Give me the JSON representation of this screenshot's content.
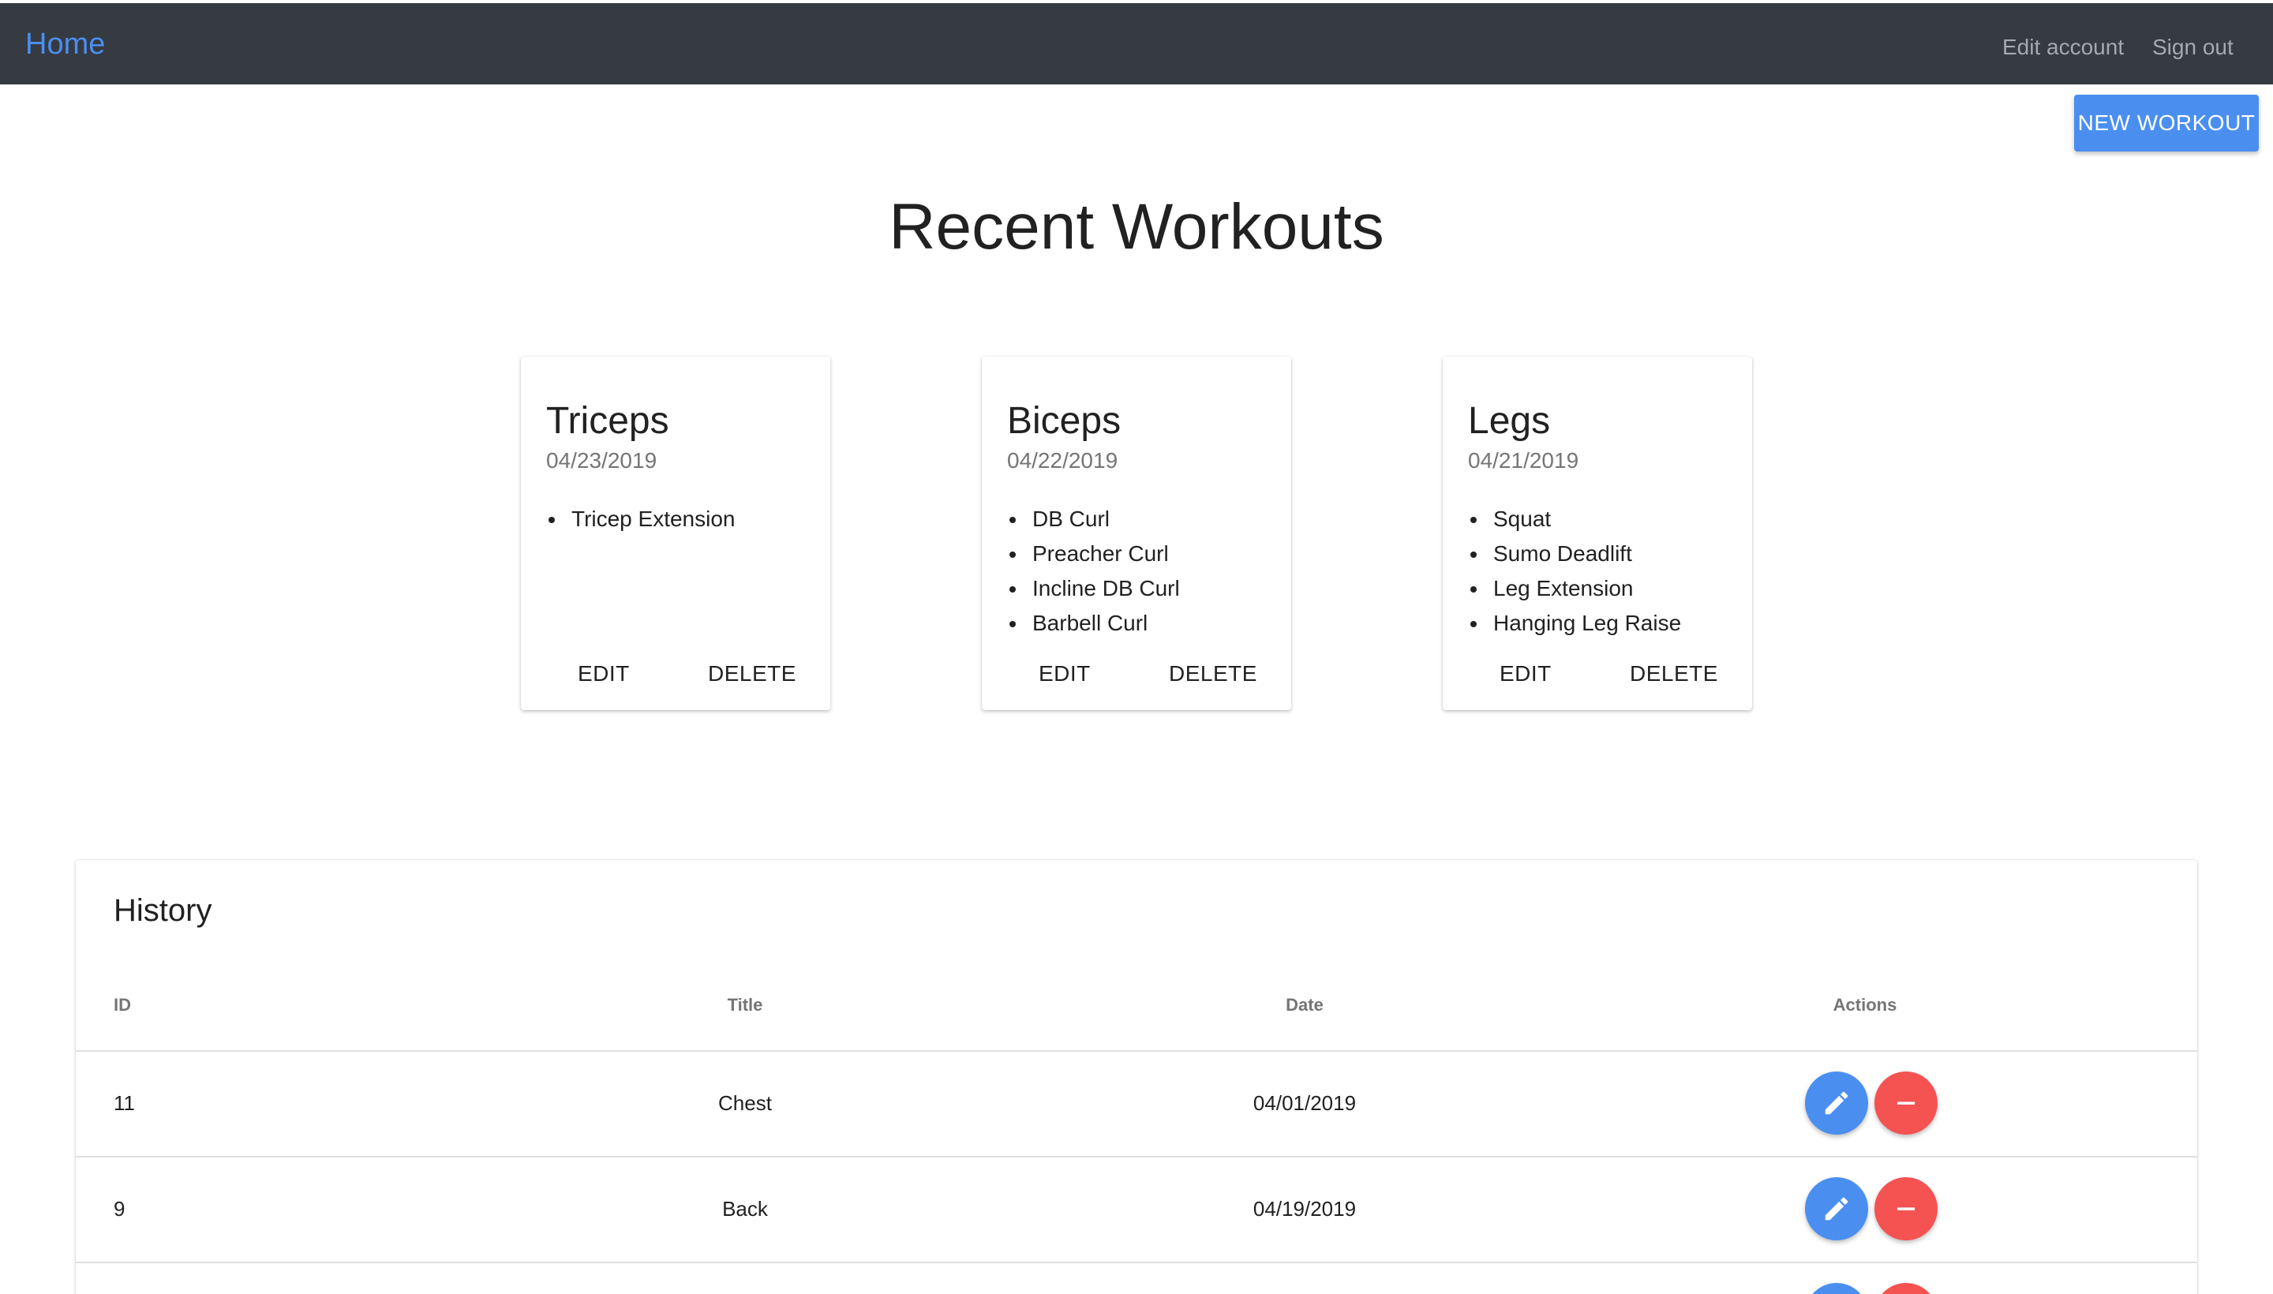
{
  "navbar": {
    "home_label": "Home",
    "edit_account_label": "Edit account",
    "sign_out_label": "Sign out"
  },
  "new_workout_label": "NEW WORKOUT",
  "page_title": "Recent Workouts",
  "cards": [
    {
      "title": "Triceps",
      "date": "04/23/2019",
      "exercises": [
        "Tricep Extension"
      ],
      "edit_label": "EDIT",
      "delete_label": "DELETE"
    },
    {
      "title": "Biceps",
      "date": "04/22/2019",
      "exercises": [
        "DB Curl",
        "Preacher Curl",
        "Incline DB Curl",
        "Barbell Curl"
      ],
      "edit_label": "EDIT",
      "delete_label": "DELETE"
    },
    {
      "title": "Legs",
      "date": "04/21/2019",
      "exercises": [
        "Squat",
        "Sumo Deadlift",
        "Leg Extension",
        "Hanging Leg Raise"
      ],
      "edit_label": "EDIT",
      "delete_label": "DELETE"
    }
  ],
  "history": {
    "title": "History",
    "columns": [
      "ID",
      "Title",
      "Date",
      "Actions"
    ],
    "rows": [
      {
        "id": "11",
        "title": "Chest",
        "date": "04/01/2019"
      },
      {
        "id": "9",
        "title": "Back",
        "date": "04/19/2019"
      }
    ],
    "icons": {
      "edit": "pencil-icon",
      "delete": "minus-icon"
    }
  },
  "colors": {
    "navbar_bg": "#363a41",
    "accent": "#4a8ff0",
    "danger": "#f55252"
  }
}
